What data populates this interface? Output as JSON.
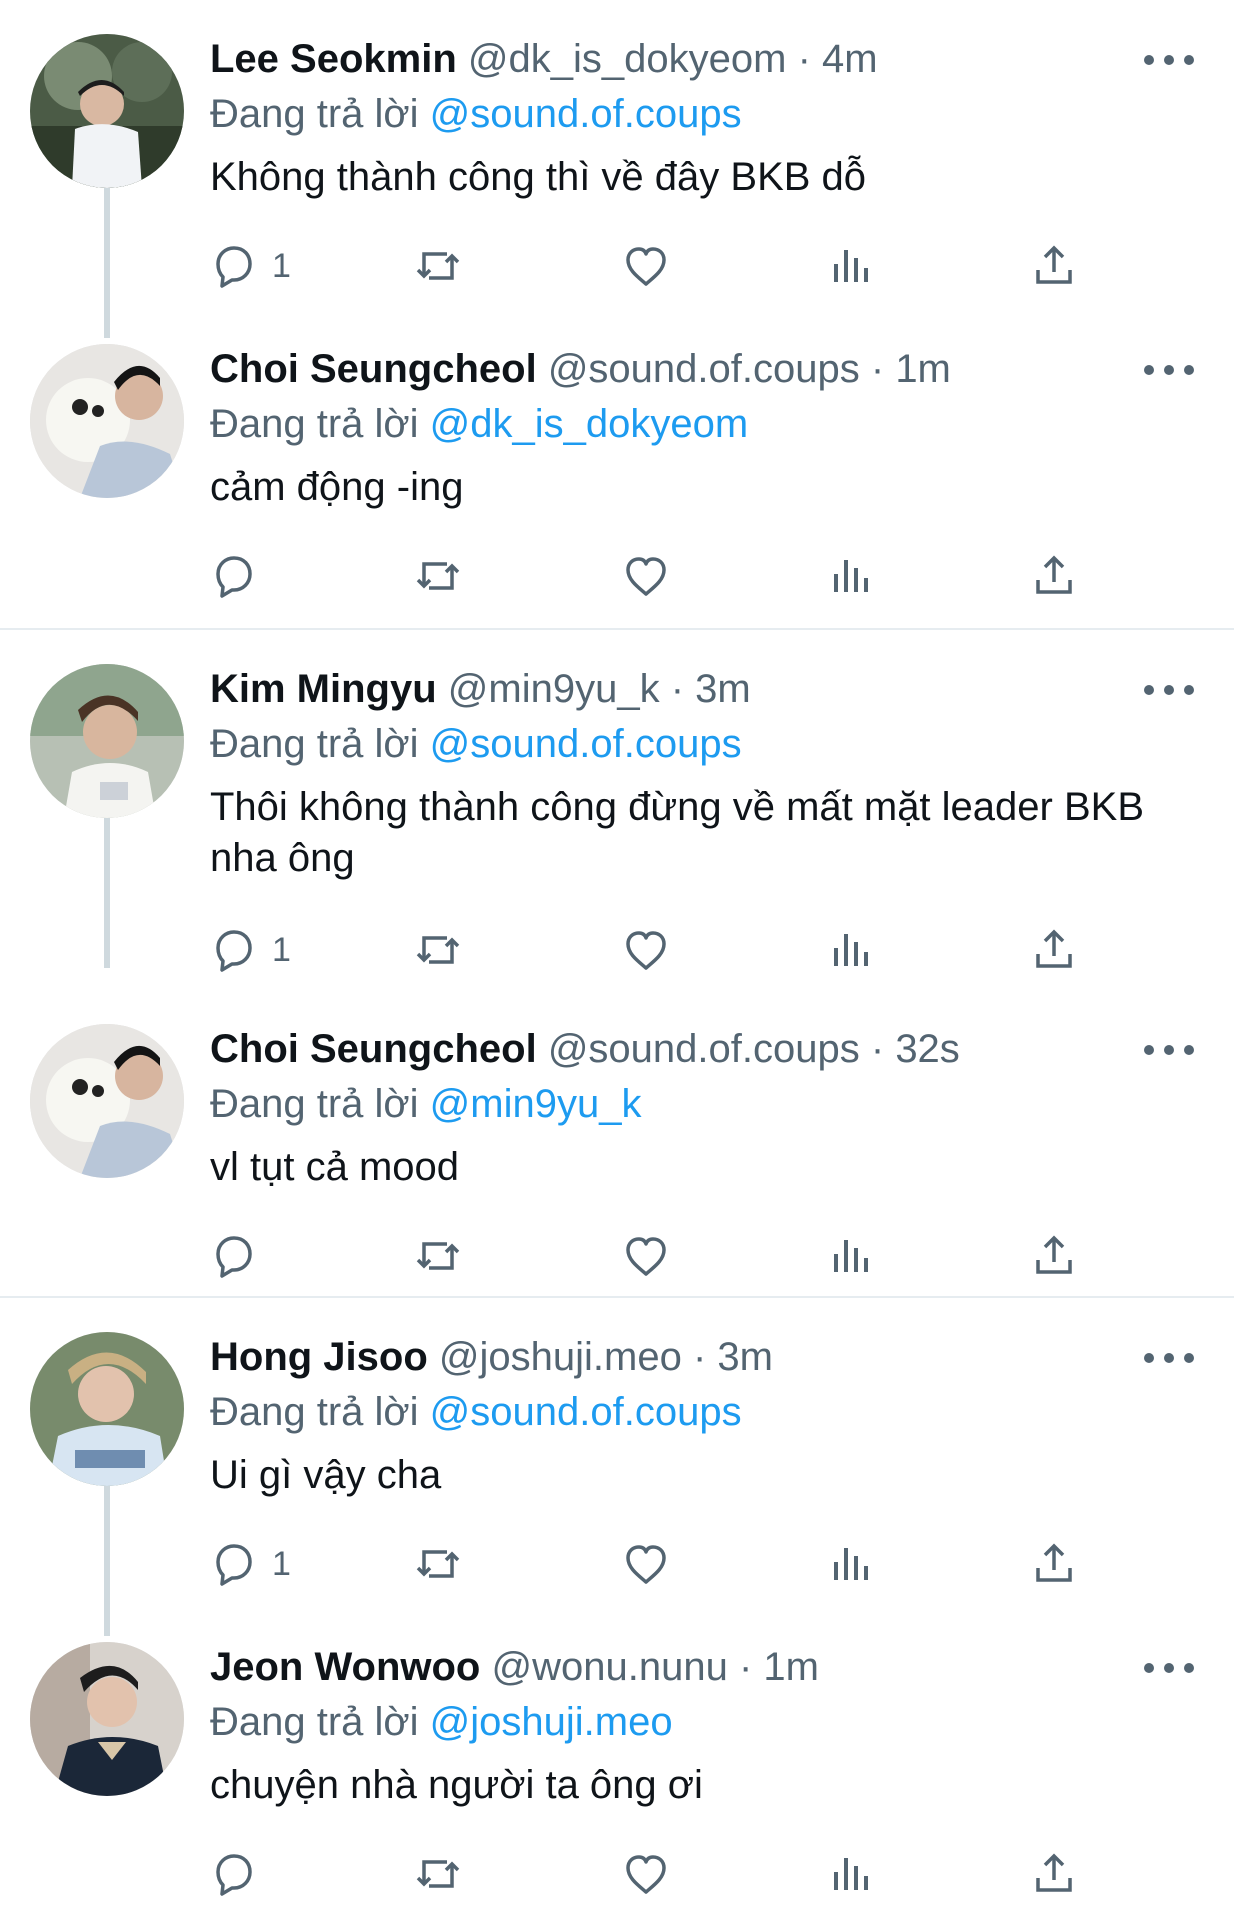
{
  "feed": {
    "threads": [
      {
        "tweets": [
          {
            "name": "Lee Seokmin",
            "handle": "@dk_is_dokyeom",
            "dot": "·",
            "time": "4m",
            "reply_prefix": "Đang trả lời",
            "reply_to": "@sound.of.coups",
            "text": "Không thành công thì về đây BKB dỗ",
            "reply_count": "1"
          },
          {
            "name": "Choi Seungcheol",
            "handle": "@sound.of.coups",
            "dot": "·",
            "time": "1m",
            "reply_prefix": "Đang trả lời",
            "reply_to": "@dk_is_dokyeom",
            "text": "cảm động -ing",
            "reply_count": ""
          }
        ]
      },
      {
        "tweets": [
          {
            "name": "Kim Mingyu",
            "handle": "@min9yu_k",
            "dot": "·",
            "time": "3m",
            "reply_prefix": "Đang trả lời",
            "reply_to": "@sound.of.coups",
            "text": "Thôi không thành công đừng về mất mặt leader BKB nha ông",
            "reply_count": "1"
          },
          {
            "name": "Choi Seungcheol",
            "handle": "@sound.of.coups",
            "dot": "·",
            "time": "32s",
            "reply_prefix": "Đang trả lời",
            "reply_to": "@min9yu_k",
            "text": "vl tụt cả mood",
            "reply_count": ""
          }
        ]
      },
      {
        "tweets": [
          {
            "name": "Hong Jisoo",
            "handle": "@joshuji.meo",
            "dot": "·",
            "time": "3m",
            "reply_prefix": "Đang trả lời",
            "reply_to": "@sound.of.coups",
            "text": "Ui gì vậy cha",
            "reply_count": "1"
          },
          {
            "name": "Jeon Wonwoo",
            "handle": "@wonu.nunu",
            "dot": "·",
            "time": "1m",
            "reply_prefix": "Đang trả lời",
            "reply_to": "@joshuji.meo",
            "text": "chuyện nhà người ta ông ơi",
            "reply_count": ""
          }
        ]
      }
    ]
  },
  "colors": {
    "text": "#0f1419",
    "secondary": "#536471",
    "link": "#1d9bf0",
    "divider": "#e6ecf0",
    "thread_line": "#cfd9de"
  },
  "icons": {
    "reply": "reply-icon",
    "retweet": "retweet-icon",
    "like": "like-icon",
    "views": "views-icon",
    "share": "share-icon",
    "more": "more-icon"
  }
}
